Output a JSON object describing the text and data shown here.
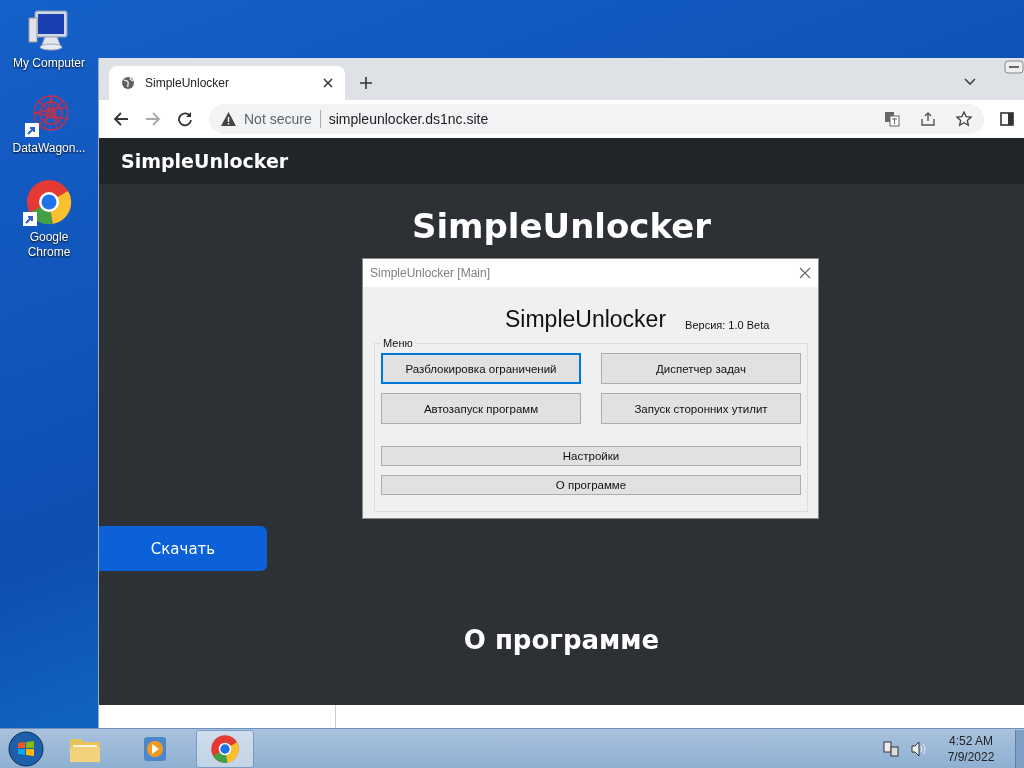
{
  "desktop": {
    "icons": [
      {
        "label": "My Computer",
        "kind": "computer",
        "shortcut": false
      },
      {
        "label": "DataWagon...",
        "kind": "burst",
        "shortcut": true
      },
      {
        "label": "Google Chrome",
        "kind": "chrome",
        "shortcut": true
      }
    ]
  },
  "browser": {
    "tabs": [
      {
        "title": "SimpleUnlocker",
        "selected": true
      }
    ],
    "security": "Not secure",
    "url": "simpleunlocker.ds1nc.site"
  },
  "page": {
    "brand": "SimpleUnlocker",
    "heading": "SimpleUnlocker",
    "download_button": "Скачать",
    "section_heading": "О программе"
  },
  "dialog": {
    "title": "SimpleUnlocker [Main]",
    "app_name": "SimpleUnlocker",
    "version": "Версия: 1.0 Beta",
    "group": "Меню",
    "buttons": [
      {
        "label": "Разблокировка ограничений",
        "kind": "large",
        "focused": true
      },
      {
        "label": "Диспетчер задач",
        "kind": "large",
        "focused": false
      },
      {
        "label": "Автозапуск программ",
        "kind": "large",
        "focused": false
      },
      {
        "label": "Запуск сторонних утилит",
        "kind": "large",
        "focused": false
      },
      {
        "label": "Настройки",
        "kind": "wide",
        "focused": false
      },
      {
        "label": "О программе",
        "kind": "wide",
        "focused": false
      }
    ]
  },
  "taskbar": {
    "apps": [
      {
        "kind": "folder",
        "selected": false
      },
      {
        "kind": "media",
        "selected": false
      },
      {
        "kind": "chrome",
        "selected": true
      }
    ],
    "time": "4:52 AM",
    "date": "7/9/2022"
  }
}
